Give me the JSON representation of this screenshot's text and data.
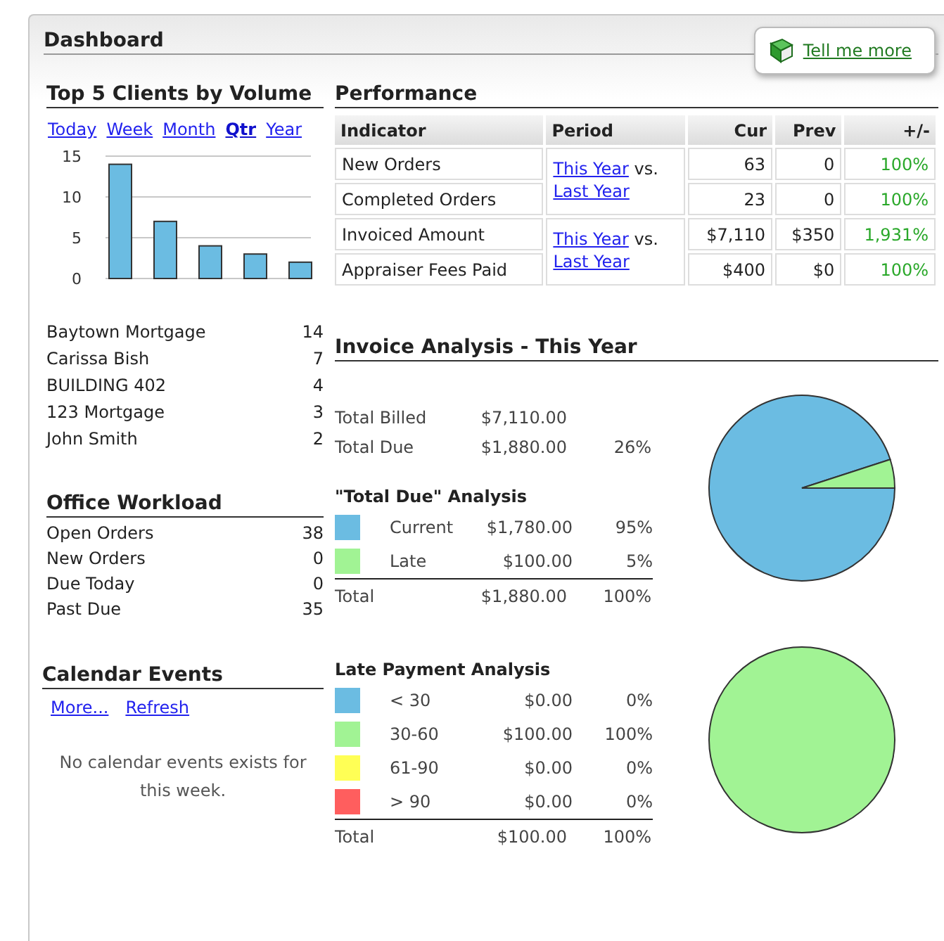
{
  "title": "Dashboard",
  "help_button": {
    "label": "Tell me more"
  },
  "top_clients": {
    "title": "Top 5 Clients by Volume",
    "periods": [
      {
        "label": "Today",
        "selected": false
      },
      {
        "label": "Week",
        "selected": false
      },
      {
        "label": "Month",
        "selected": false
      },
      {
        "label": "Qtr",
        "selected": true
      },
      {
        "label": "Year",
        "selected": false
      }
    ],
    "chart_data": {
      "type": "bar",
      "values": [
        14,
        7,
        4,
        3,
        2
      ],
      "ylim": [
        0,
        15
      ],
      "yticks": [
        0,
        5,
        10,
        15
      ]
    },
    "clients": [
      {
        "name": "Baytown Mortgage",
        "count": "14"
      },
      {
        "name": "Carissa Bish",
        "count": "7"
      },
      {
        "name": "BUILDING 402",
        "count": "4"
      },
      {
        "name": "123 Mortgage",
        "count": "3"
      },
      {
        "name": "John Smith",
        "count": "2"
      }
    ]
  },
  "office_workload": {
    "title": "Office Workload",
    "rows": [
      {
        "label": "Open Orders",
        "value": "38"
      },
      {
        "label": "New Orders",
        "value": "0"
      },
      {
        "label": "Due Today",
        "value": "0"
      },
      {
        "label": "Past Due",
        "value": "35"
      }
    ]
  },
  "calendar": {
    "title": "Calendar Events",
    "links": [
      "More...",
      "Refresh"
    ],
    "message": "No calendar events exists for this week."
  },
  "performance": {
    "title": "Performance",
    "columns": [
      "Indicator",
      "Period",
      "Cur",
      "Prev",
      "+/-"
    ],
    "groups": [
      {
        "period": {
          "link_1": "This Year",
          "joiner": "vs.",
          "link_2": "Last Year"
        },
        "rows": [
          {
            "indicator": "New Orders",
            "cur": "63",
            "prev": "0",
            "change": "100%"
          },
          {
            "indicator": "Completed Orders",
            "cur": "23",
            "prev": "0",
            "change": "100%"
          }
        ]
      },
      {
        "period": {
          "link_1": "This Year",
          "joiner": "vs.",
          "link_2": "Last Year"
        },
        "rows": [
          {
            "indicator": "Invoiced Amount",
            "cur": "$7,110",
            "prev": "$350",
            "change": "1,931%"
          },
          {
            "indicator": "Appraiser Fees Paid",
            "cur": "$400",
            "prev": "$0",
            "change": "100%"
          }
        ]
      }
    ]
  },
  "invoice_analysis": {
    "title": "Invoice Analysis - This Year",
    "summary": [
      {
        "label": "Total Billed",
        "amount": "$7,110.00"
      },
      {
        "label": "Total Due",
        "amount": "$1,880.00",
        "percent": "26%"
      }
    ],
    "sections": [
      {
        "title": "\"Total Due\" Analysis",
        "rows": [
          {
            "label": "Current",
            "amount": "$1,780.00",
            "percent": "95%",
            "color": "#6bbce2"
          },
          {
            "label": "Late",
            "amount": "$100.00",
            "percent": "5%",
            "color": "#a1f394"
          }
        ],
        "total": {
          "label": "Total",
          "amount": "$1,880.00",
          "percent": "100%"
        },
        "chart_data": {
          "type": "pie",
          "values": [
            95,
            5
          ]
        }
      },
      {
        "title": "Late Payment Analysis",
        "rows": [
          {
            "label": "< 30",
            "amount": "$0.00",
            "percent": "0%",
            "color": "#6bbce2"
          },
          {
            "label": "30-60",
            "amount": "$100.00",
            "percent": "100%",
            "color": "#a1f394"
          },
          {
            "label": "61-90",
            "amount": "$0.00",
            "percent": "0%",
            "color": "#ffff55"
          },
          {
            "label": "> 90",
            "amount": "$0.00",
            "percent": "0%",
            "color": "#ff5e5e"
          }
        ],
        "total": {
          "label": "Total",
          "amount": "$100.00",
          "percent": "100%"
        },
        "chart_data": {
          "type": "pie",
          "values": [
            0,
            100,
            0,
            0
          ]
        }
      }
    ]
  }
}
